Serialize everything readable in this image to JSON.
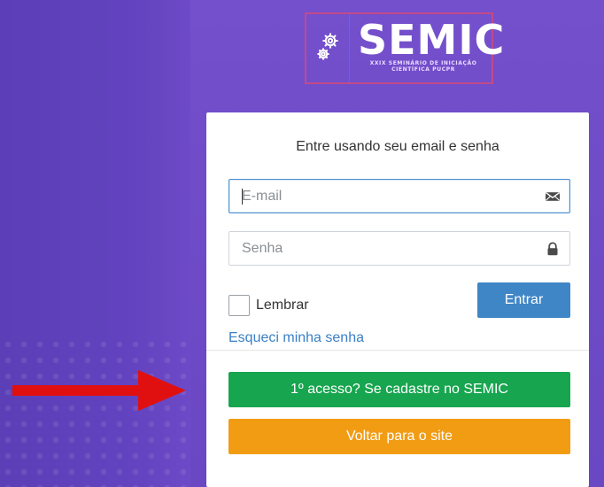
{
  "logo": {
    "wordmark": "SEMIC",
    "subtitle_line1": "XXIX SEMINÁRIO DE INICIAÇÃO",
    "subtitle_line2": "CIENTÍFICA PUCPR",
    "icon": "gears-icon"
  },
  "login": {
    "title": "Entre usando seu email e senha",
    "email": {
      "placeholder": "E-mail",
      "value": "",
      "icon": "envelope-icon"
    },
    "password": {
      "placeholder": "Senha",
      "value": "",
      "icon": "lock-icon"
    },
    "remember_label": "Lembrar",
    "submit_label": "Entrar",
    "forgot_label": "Esqueci minha senha"
  },
  "actions": {
    "register_label": "1º acesso? Se cadastre no SEMIC",
    "back_label": "Voltar para o site"
  },
  "colors": {
    "primary": "#3f86c6",
    "green": "#17a54f",
    "orange": "#f29c14",
    "purple": "#6a4cc6",
    "arrow_red": "#e01010"
  }
}
